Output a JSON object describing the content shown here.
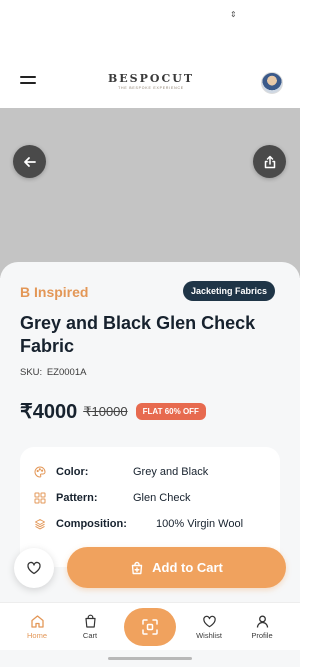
{
  "status_bar": {
    "icon": "network-updown-icon"
  },
  "header": {
    "logo_main": "BESPOCUT",
    "logo_tag": "THE BESPOKE EXPERIENCE",
    "menu_icon": "hamburger-menu-icon",
    "avatar_icon": "user-avatar"
  },
  "hero": {
    "back_icon": "arrow-left-icon",
    "share_icon": "share-icon"
  },
  "product": {
    "brand": "B Inspired",
    "category": "Jacketing Fabrics",
    "title": "Grey and Black Glen Check Fabric",
    "sku_label": "SKU:",
    "sku": "EZ0001A",
    "price": "₹4000",
    "mrp": "₹10000",
    "discount": "FLAT 60% OFF"
  },
  "specs": [
    {
      "label": "Color:",
      "value": "Grey and Black",
      "icon": "palette-icon"
    },
    {
      "label": "Pattern:",
      "value": "Glen Check",
      "icon": "grid-pattern-icon"
    },
    {
      "label": "Composition:",
      "value": "100% Virgin Wool",
      "icon": "layers-icon"
    }
  ],
  "actions": {
    "wishlist_icon": "heart-icon",
    "add_to_cart": "Add to Cart",
    "cart_icon": "shopping-bag-plus-icon"
  },
  "nav": {
    "items": [
      {
        "label": "Home",
        "icon": "home-icon",
        "active": true
      },
      {
        "label": "Cart",
        "icon": "cart-icon",
        "active": false
      },
      {
        "label": "Wishlist",
        "icon": "heart-icon",
        "active": false
      },
      {
        "label": "Profile",
        "icon": "user-icon",
        "active": false
      }
    ],
    "scan_icon": "scan-icon"
  },
  "colors": {
    "accent": "#F0A25E",
    "brand_text": "#E39757",
    "navy": "#1F3547",
    "discount": "#E76A4F",
    "hero_bg": "#C4C4C4"
  }
}
